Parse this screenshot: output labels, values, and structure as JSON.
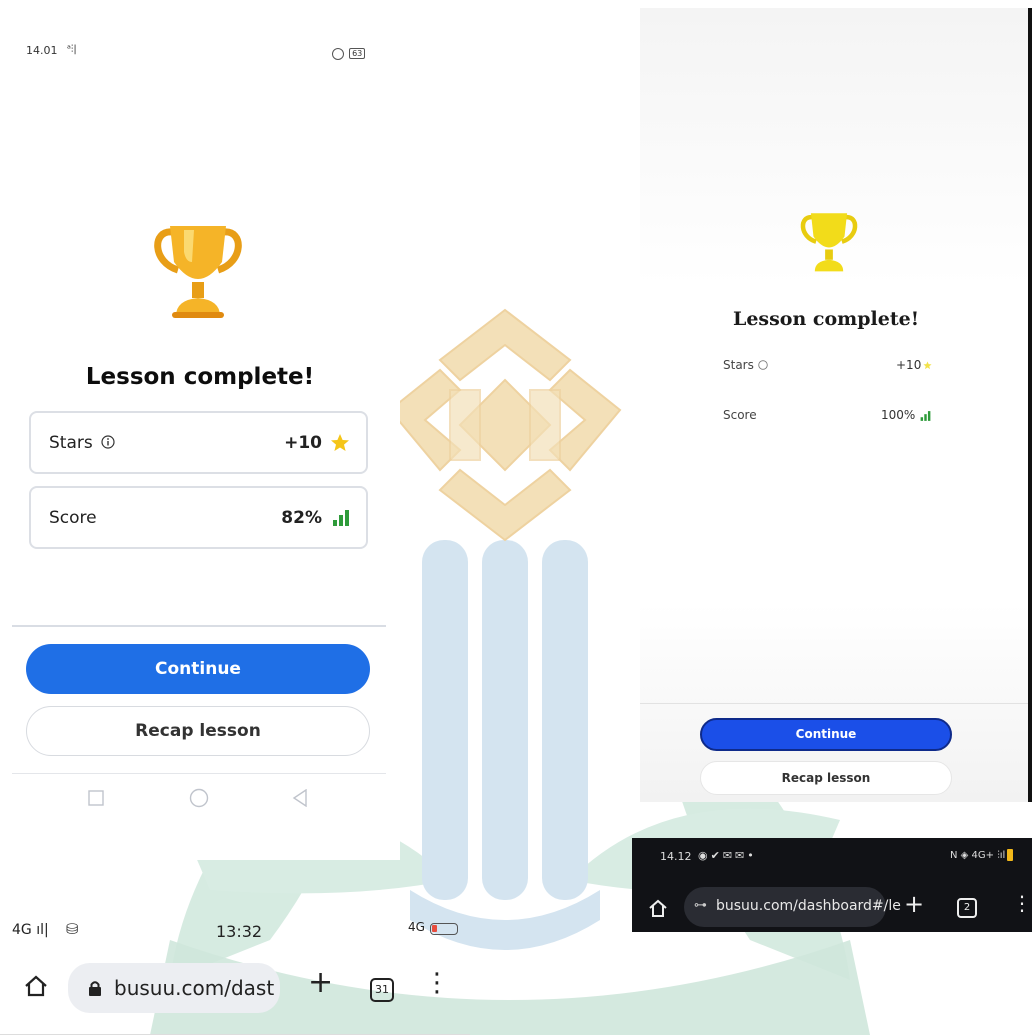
{
  "panel_a": {
    "status_time": "14.01",
    "status_battery": "63",
    "title": "Lesson complete!",
    "stars_label": "Stars",
    "stars_value": "+10",
    "score_label": "Score",
    "score_value": "82%",
    "continue_label": "Continue",
    "recap_label": "Recap lesson"
  },
  "panel_b": {
    "title": "Lesson complete!",
    "stars_label": "Stars",
    "stars_value": "+10",
    "score_label": "Score",
    "score_value": "100%",
    "continue_label": "Continue",
    "recap_label": "Recap lesson"
  },
  "panel_c": {
    "status_time": "14.12",
    "status_network": "4G+",
    "url": "busuu.com/dashboard#/le",
    "tab_count": "2"
  },
  "panel_d": {
    "status_network": "4G",
    "status_time": "13:32",
    "status_network_right": "4G",
    "url": "busuu.com/dast",
    "tab_count": "31"
  },
  "colors": {
    "accent_blue": "#1f6fe6",
    "trophy_gold": "#f5b428",
    "star_yellow": "#f5c518",
    "score_green": "#2e9b3a",
    "watermark_gold": "#f3e0b8",
    "watermark_green": "#cfe7dc",
    "watermark_blue": "#d4e4f0"
  },
  "icons": [
    "trophy-icon",
    "info-icon",
    "star-icon",
    "signal-bars-icon",
    "home-icon",
    "lock-icon",
    "plus-icon",
    "tabs-icon",
    "more-icon",
    "square-nav-icon",
    "circle-nav-icon",
    "back-nav-icon"
  ]
}
